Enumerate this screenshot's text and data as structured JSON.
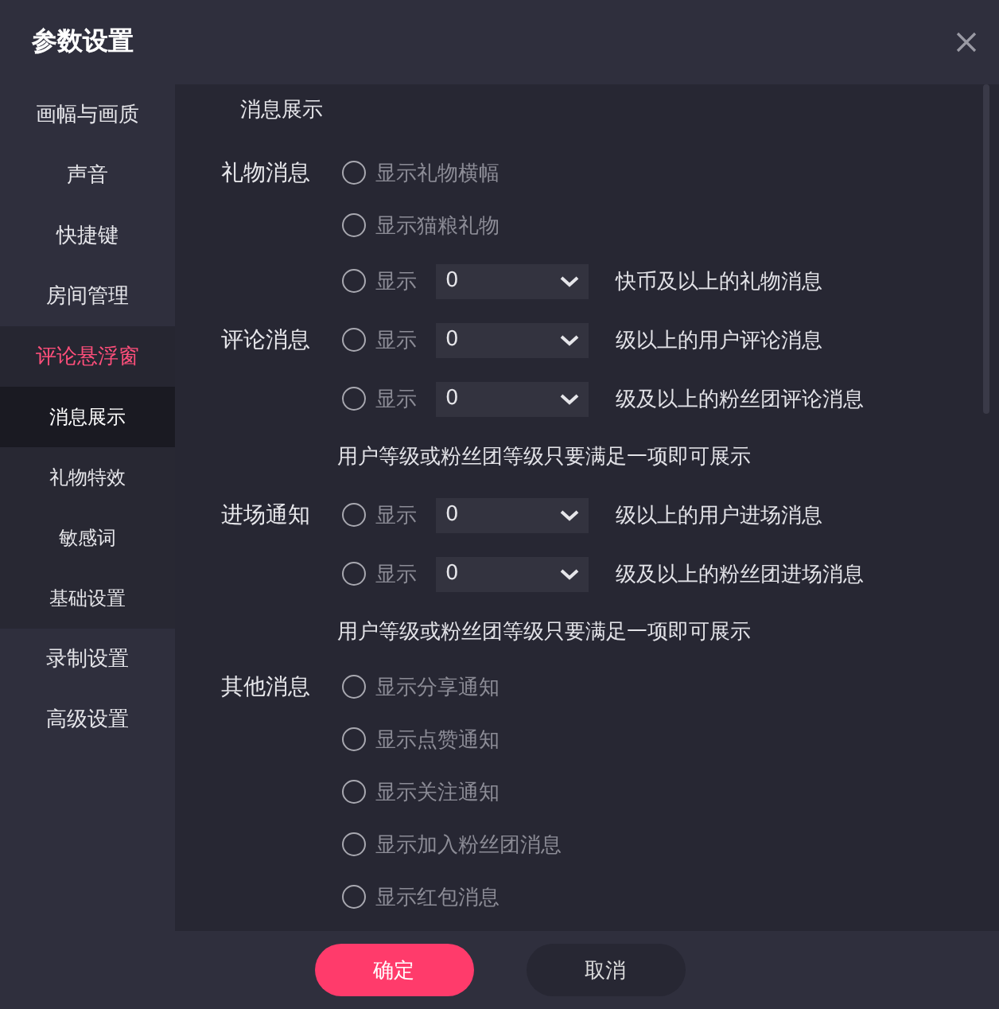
{
  "window": {
    "title": "参数设置"
  },
  "sidebar": {
    "items": [
      {
        "label": "画幅与画质",
        "kind": "item",
        "selected": false
      },
      {
        "label": "声音",
        "kind": "item",
        "selected": false
      },
      {
        "label": "快捷键",
        "kind": "item",
        "selected": false
      },
      {
        "label": "房间管理",
        "kind": "item",
        "selected": false
      },
      {
        "label": "评论悬浮窗",
        "kind": "item",
        "selected": true
      },
      {
        "label": "消息展示",
        "kind": "subitem",
        "selected": true
      },
      {
        "label": "礼物特效",
        "kind": "subitem",
        "selected": false
      },
      {
        "label": "敏感词",
        "kind": "subitem",
        "selected": false
      },
      {
        "label": "基础设置",
        "kind": "subitem",
        "selected": false
      },
      {
        "label": "录制设置",
        "kind": "item",
        "selected": false
      },
      {
        "label": "高级设置",
        "kind": "item",
        "selected": false
      }
    ]
  },
  "content": {
    "title": "消息展示",
    "rows": [
      {
        "kind": "check",
        "label": "礼物消息",
        "text": "显示礼物横幅",
        "checked": false
      },
      {
        "kind": "check",
        "text": "显示猫粮礼物",
        "checked": false
      },
      {
        "kind": "select",
        "text": "显示",
        "value": "0",
        "suffix": "快币及以上的礼物消息",
        "checked": false
      },
      {
        "kind": "select",
        "label": "评论消息",
        "text": "显示",
        "value": "0",
        "suffix": "级以上的用户评论消息",
        "checked": false
      },
      {
        "kind": "select",
        "text": "显示",
        "value": "0",
        "suffix": "级及以上的粉丝团评论消息",
        "checked": false
      },
      {
        "kind": "note",
        "text": "用户等级或粉丝团等级只要满足一项即可展示"
      },
      {
        "kind": "select",
        "label": "进场通知",
        "text": "显示",
        "value": "0",
        "suffix": "级以上的用户进场消息",
        "checked": false
      },
      {
        "kind": "select",
        "text": "显示",
        "value": "0",
        "suffix": "级及以上的粉丝团进场消息",
        "checked": false
      },
      {
        "kind": "note",
        "text": "用户等级或粉丝团等级只要满足一项即可展示"
      },
      {
        "kind": "check",
        "label": "其他消息",
        "text": "显示分享通知",
        "checked": false
      },
      {
        "kind": "check",
        "text": "显示点赞通知",
        "checked": false
      },
      {
        "kind": "check",
        "text": "显示关注通知",
        "checked": false
      },
      {
        "kind": "check",
        "text": "显示加入粉丝团消息",
        "checked": false
      },
      {
        "kind": "check",
        "text": "显示红包消息",
        "checked": false
      }
    ]
  },
  "buttons": [
    {
      "label": "确定",
      "kind": "primary"
    },
    {
      "label": "取消",
      "kind": "secondary"
    }
  ]
}
